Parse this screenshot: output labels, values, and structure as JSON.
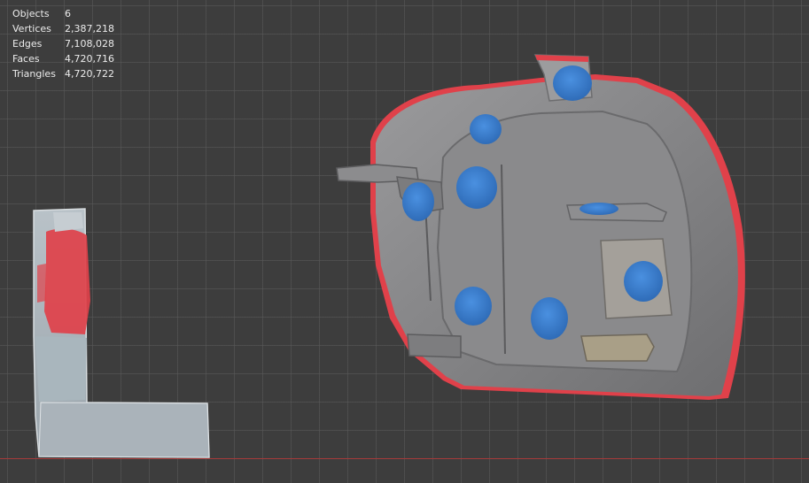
{
  "statistics": [
    {
      "label": "Objects",
      "value": "6"
    },
    {
      "label": "Vertices",
      "value": "2,387,218"
    },
    {
      "label": "Edges",
      "value": "7,108,028"
    },
    {
      "label": "Faces",
      "value": "4,720,716"
    },
    {
      "label": "Triangles",
      "value": "4,720,722"
    }
  ],
  "colors": {
    "background": "#3d3d3d",
    "grid": "#5a5a5a",
    "x_axis": "#a63a3a",
    "mesh_gray": "#7f7f80",
    "mesh_highlight": "#e0414a",
    "marker_blue": "#3c7fd0"
  }
}
